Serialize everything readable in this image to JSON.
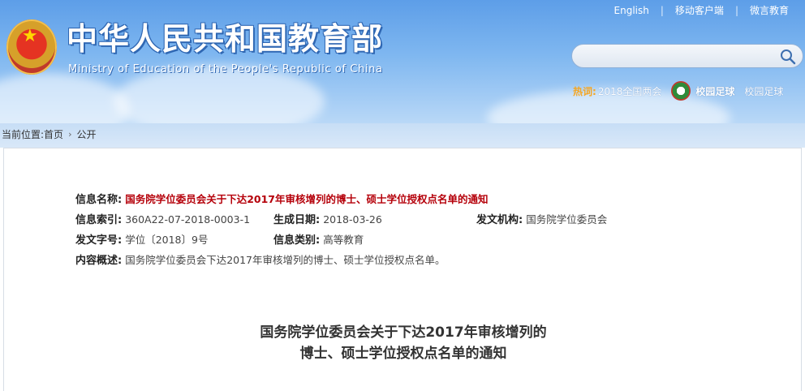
{
  "header": {
    "title": "中华人民共和国教育部",
    "subtitle": "Ministry of Education of the People's Republic of China",
    "links": [
      "English",
      "移动客户端",
      "微言教育"
    ],
    "search": {
      "placeholder": ""
    },
    "hot": {
      "label": "热词:",
      "link1": "2018全国两会",
      "football": "校园足球",
      "link2": "校园足球"
    }
  },
  "breadcrumb": {
    "prefix": "当前位置:",
    "items": [
      "首页",
      "公开"
    ]
  },
  "info": {
    "name_label": "信息名称:",
    "name_value": "国务院学位委员会关于下达2017年审核增列的博士、硕士学位授权点名单的通知",
    "index_label": "信息索引:",
    "index_value": "360A22-07-2018-0003-1",
    "date_label": "生成日期:",
    "date_value": "2018-03-26",
    "issuer_label": "发文机构:",
    "issuer_value": "国务院学位委员会",
    "docno_label": "发文字号:",
    "docno_value": "学位〔2018〕9号",
    "category_label": "信息类别:",
    "category_value": "高等教育",
    "summary_label": "内容概述:",
    "summary_value": "国务院学位委员会下达2017年审核增列的博士、硕士学位授权点名单。"
  },
  "document": {
    "title_line1": "国务院学位委员会关于下达2017年审核增列的",
    "title_line2": "博士、硕士学位授权点名单的通知"
  },
  "colors": {
    "header_blue": "#5d9ee8",
    "title_red": "#b5000a",
    "hot_orange": "#f5a623"
  }
}
